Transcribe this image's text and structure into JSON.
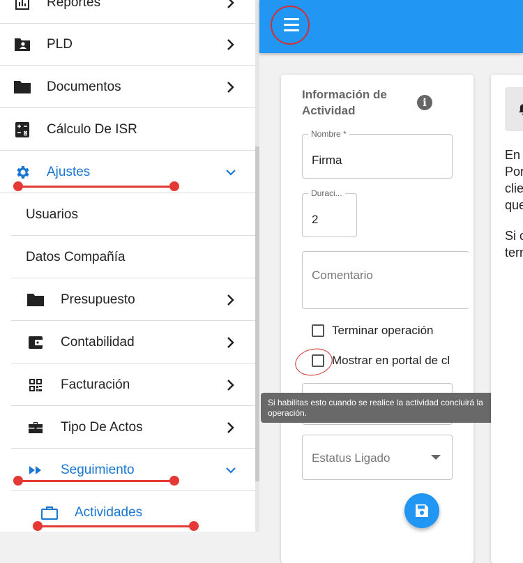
{
  "sidebar": {
    "items": [
      {
        "label": "Reportes",
        "icon": "bar-chart-icon"
      },
      {
        "label": "PLD",
        "icon": "folder-account-icon"
      },
      {
        "label": "Documentos",
        "icon": "folder-icon"
      },
      {
        "label": "Cálculo De ISR",
        "icon": "calculator-icon"
      },
      {
        "label": "Ajustes",
        "icon": "gear-icon"
      },
      {
        "label": "Usuarios"
      },
      {
        "label": "Datos Compañía"
      },
      {
        "label": "Presupuesto",
        "icon": "folder-icon"
      },
      {
        "label": "Contabilidad",
        "icon": "wallet-icon"
      },
      {
        "label": "Facturación",
        "icon": "qr-code-icon"
      },
      {
        "label": "Tipo De Actos",
        "icon": "briefcase-icon"
      },
      {
        "label": "Seguimiento",
        "icon": "fast-forward-icon"
      },
      {
        "label": "Actividades",
        "icon": "briefcase-outline-icon"
      }
    ],
    "accent_color": "#1976d2"
  },
  "topbar": {
    "color": "#2196f3"
  },
  "activity_card": {
    "title": "Información de Actividad",
    "name_label": "Nombre *",
    "name_value": "Firma",
    "duration_label": "Duraci...",
    "duration_value": "2",
    "comment_placeholder": "Comentario",
    "finish_label": "Terminar operación",
    "portal_label": "Mostrar en portal de cl",
    "status_placeholder": "Estatus Ligado"
  },
  "tooltip": "Si habilitas esto cuando se realice la actividad concluirá la operación.",
  "second_card": {
    "lines": [
      "En",
      "Por",
      "clie",
      "que",
      "Si c",
      "tern"
    ]
  }
}
